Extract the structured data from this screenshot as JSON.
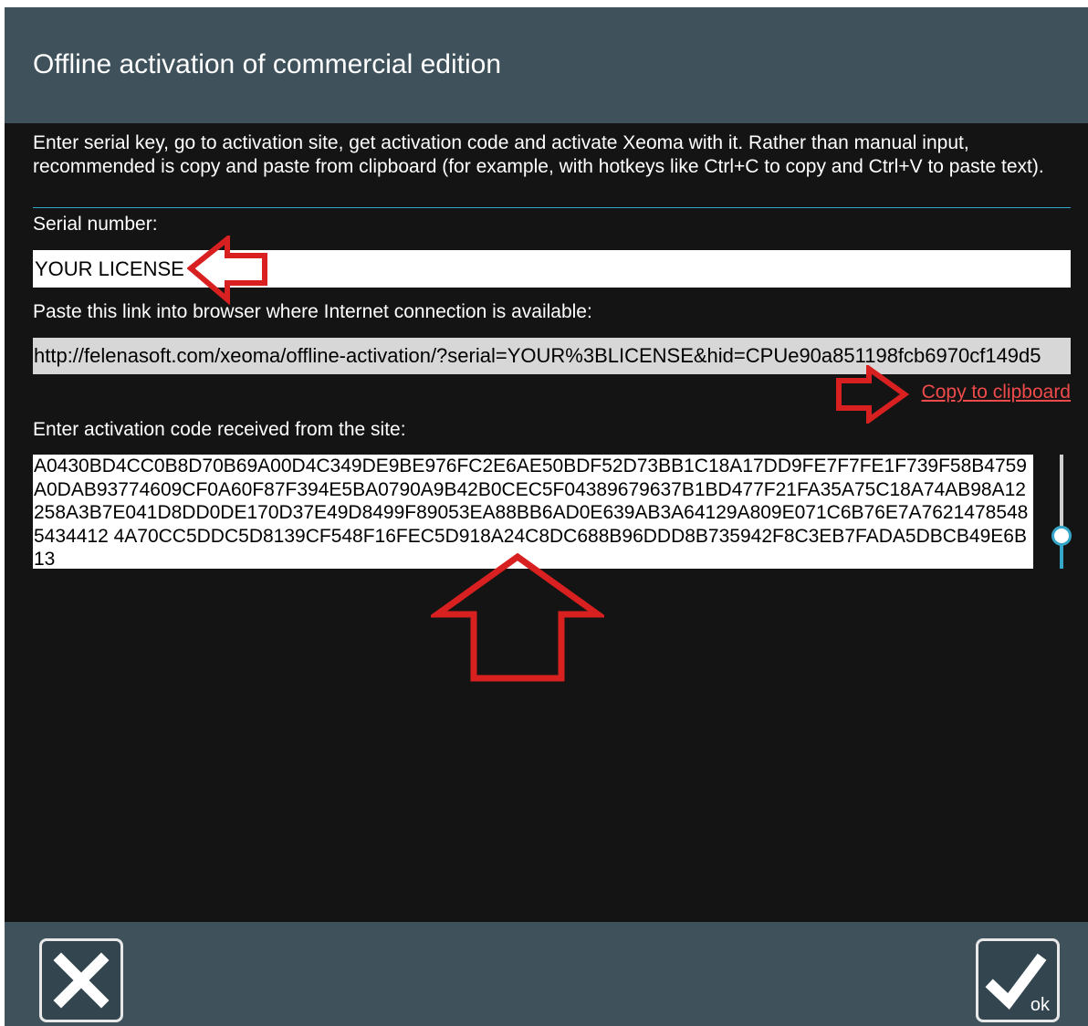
{
  "dialog": {
    "title": "Offline activation of commercial edition",
    "intro": "Enter serial key, go to activation site, get activation code and activate Xeoma with it. Rather than manual input, recommended is copy and paste from clipboard (for example, with hotkeys like Ctrl+C to copy and Ctrl+V to paste text).",
    "serial_label": "Serial number:",
    "serial_value": "YOUR LICENSE",
    "link_label": "Paste this link into browser where Internet connection is available:",
    "link_value": "http://felenasoft.com/xeoma/offline-activation/?serial=YOUR%3BLICENSE&hid=CPUe90a851198fcb6970cf149d5",
    "copy_label": "Copy to clipboard",
    "code_label": "Enter activation code received from the site:",
    "code_value": "A0430BD4CC0B8D70B69A00D4C349DE9BE976FC2E6AE50BDF52D73BB1C18A17DD9FE7F7FE1F739F58B4759A0DAB93774609CF0A60F87F394E5BA0790A9B42B0CEC5F04389679637B1BD477F21FA35A75C18A74AB98A12258A3B7E041D8DD0DE170D37E49D8499F89053EA88BB6AD0E639AB3A64129A809E071C6B76E7A76214785485434412 4A70CC5DDC5D8139CF548F16FEC5D918A24C8DC688B96DDD8B735942F8C3EB7FADA5DBCB49E6B13"
  },
  "footer": {
    "cancel_icon": "close-icon",
    "ok_icon": "check-icon",
    "ok_label": "ok"
  },
  "colors": {
    "title_bar": "#3f525c",
    "background": "#141414",
    "accent": "#34a6c8",
    "link": "#f04a4a",
    "annotation_arrow": "#d92020"
  }
}
